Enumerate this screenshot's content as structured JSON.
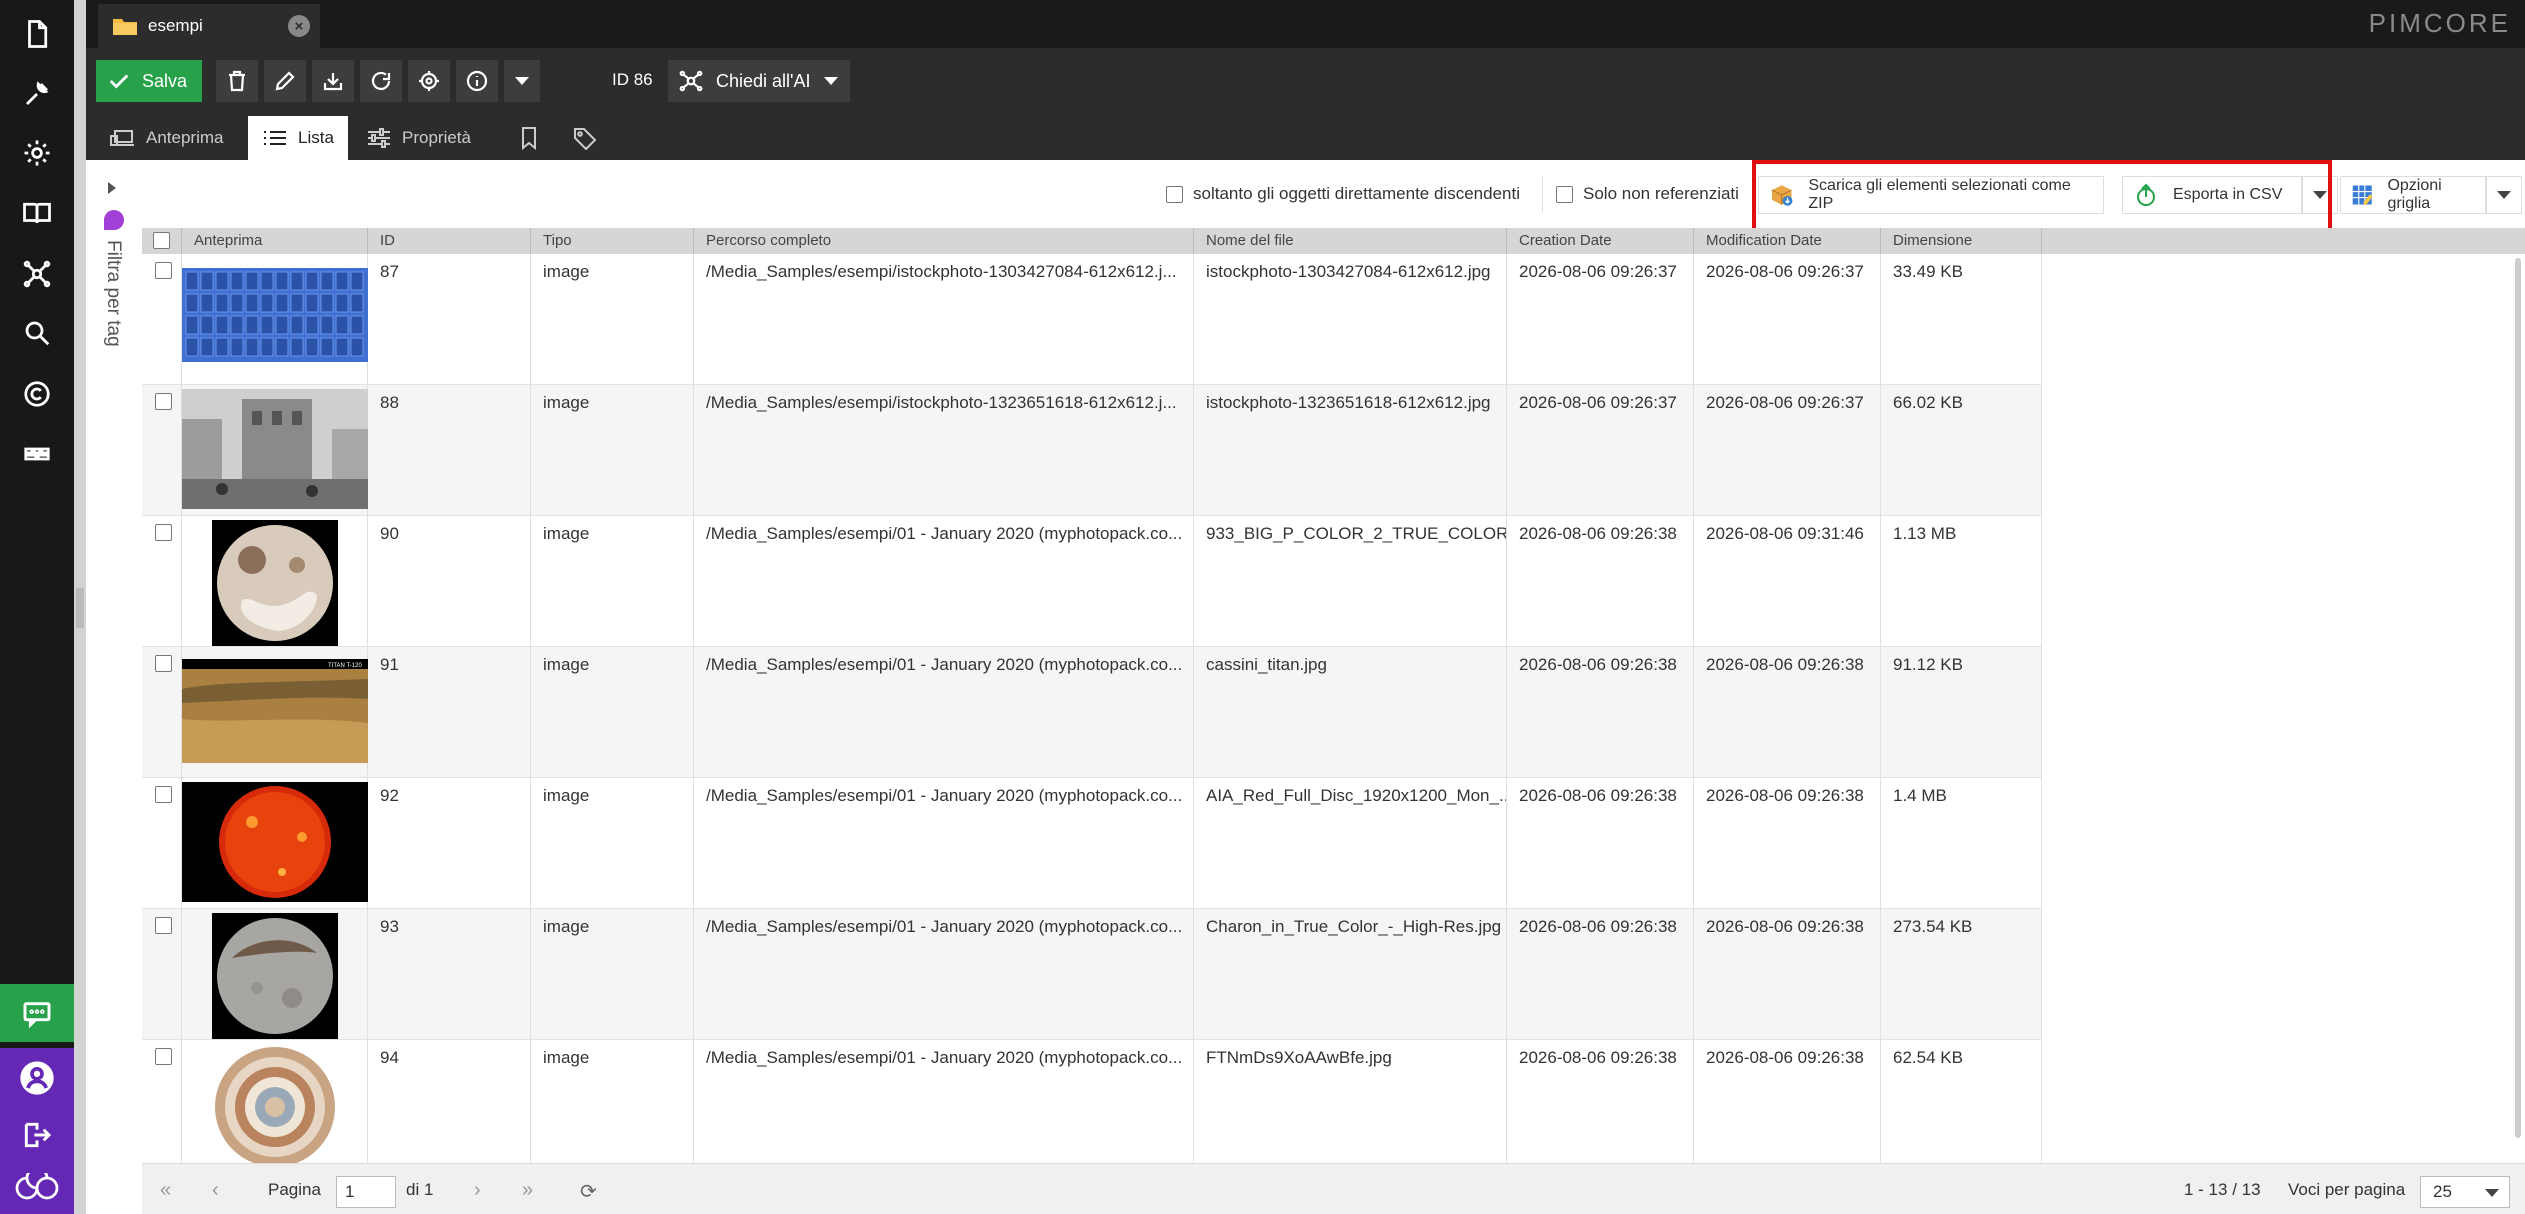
{
  "tab": {
    "title": "esempi"
  },
  "brand": "PIMCORE",
  "toolbar": {
    "save_label": "Salva",
    "id_label": "ID 86",
    "ai_label": "Chiedi all'AI"
  },
  "subtabs": [
    {
      "label": "Anteprima"
    },
    {
      "label": "Lista"
    },
    {
      "label": "Proprietà"
    }
  ],
  "filter": {
    "label": "Filtra per tag"
  },
  "gridtoolbar": {
    "direct_children_label": "soltanto gli oggetti direttamente discendenti",
    "unreferenced_label": "Solo non referenziati",
    "download_zip_label": "Scarica gli elementi selezionati come ZIP",
    "export_csv_label": "Esporta in CSV",
    "grid_options_label": "Opzioni griglia"
  },
  "columns": [
    "Anteprima",
    "ID",
    "Tipo",
    "Percorso completo",
    "Nome del file",
    "Creation Date",
    "Modification Date",
    "Dimensione"
  ],
  "rows": [
    {
      "id": "87",
      "type": "image",
      "path": "/Media_Samples/esempi/istockphoto-1303427084-612x612.j...",
      "filename": "istockphoto-1303427084-612x612.jpg",
      "created": "2026-08-06 09:26:37",
      "modified": "2026-08-06 09:26:37",
      "size": "33.49 KB",
      "thumb": "blue-grid"
    },
    {
      "id": "88",
      "type": "image",
      "path": "/Media_Samples/esempi/istockphoto-1323651618-612x612.j...",
      "filename": "istockphoto-1323651618-612x612.jpg",
      "created": "2026-08-06 09:26:37",
      "modified": "2026-08-06 09:26:37",
      "size": "66.02 KB",
      "thumb": "city-bw"
    },
    {
      "id": "90",
      "type": "image",
      "path": "/Media_Samples/esempi/01 - January 2020 (myphotopack.co...",
      "filename": "933_BIG_P_COLOR_2_TRUE_COLOR...",
      "created": "2026-08-06 09:26:38",
      "modified": "2026-08-06 09:31:46",
      "size": "1.13 MB",
      "thumb": "pluto"
    },
    {
      "id": "91",
      "type": "image",
      "path": "/Media_Samples/esempi/01 - January 2020 (myphotopack.co...",
      "filename": "cassini_titan.jpg",
      "created": "2026-08-06 09:26:38",
      "modified": "2026-08-06 09:26:38",
      "size": "91.12 KB",
      "thumb": "titan"
    },
    {
      "id": "92",
      "type": "image",
      "path": "/Media_Samples/esempi/01 - January 2020 (myphotopack.co...",
      "filename": "AIA_Red_Full_Disc_1920x1200_Mon_...",
      "created": "2026-08-06 09:26:38",
      "modified": "2026-08-06 09:26:38",
      "size": "1.4 MB",
      "thumb": "sun"
    },
    {
      "id": "93",
      "type": "image",
      "path": "/Media_Samples/esempi/01 - January 2020 (myphotopack.co...",
      "filename": "Charon_in_True_Color_-_High-Res.jpg",
      "created": "2026-08-06 09:26:38",
      "modified": "2026-08-06 09:26:38",
      "size": "273.54 KB",
      "thumb": "charon"
    },
    {
      "id": "94",
      "type": "image",
      "path": "/Media_Samples/esempi/01 - January 2020 (myphotopack.co...",
      "filename": "FTNmDs9XoAAwBfe.jpg",
      "created": "2026-08-06 09:26:38",
      "modified": "2026-08-06 09:26:38",
      "size": "62.54 KB",
      "thumb": "jupiter"
    }
  ],
  "pager": {
    "page_label": "Pagina",
    "page_value": "1",
    "of_label": "di 1",
    "count_label": "1 - 13 / 13",
    "per_page_label": "Voci per pagina",
    "per_page_value": "25"
  }
}
